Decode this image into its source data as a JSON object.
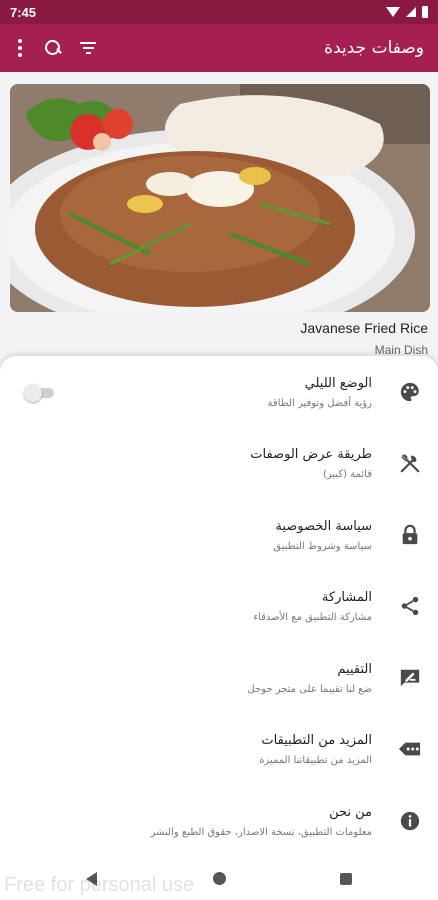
{
  "status_bar": {
    "time": "7:45"
  },
  "app_bar": {
    "title": "وصفات جديدة"
  },
  "recipe": {
    "title": "Javanese Fried Rice",
    "category": "Main Dish"
  },
  "menu": {
    "items": [
      {
        "title": "الوضع الليلي",
        "subtitle": "رؤية أفضل وتوفير الطاقة",
        "icon": "palette-icon"
      },
      {
        "title": "طريقة عرض الوصفات",
        "subtitle": "قائمة (كبير)",
        "icon": "utensils-icon"
      },
      {
        "title": "سياسة الخصوصية",
        "subtitle": "سياسة وشروط التطبيق",
        "icon": "lock-icon"
      },
      {
        "title": "المشاركة",
        "subtitle": "مشاركة التطبيق مع الأصدقاء",
        "icon": "share-icon"
      },
      {
        "title": "التقييم",
        "subtitle": "ضع لنا تقييما على متجر جوجل",
        "icon": "rate-review-icon"
      },
      {
        "title": "المزيد من التطبيقات",
        "subtitle": "المزيد من تطبيقاتنا المميزة",
        "icon": "more-apps-icon"
      },
      {
        "title": "من نحن",
        "subtitle": "معلومات التطبيق، نسخة الاصدار، حقوق الطبع والنشر",
        "icon": "info-icon"
      }
    ],
    "night_mode_enabled": false
  },
  "watermark": "Free for personal use",
  "colors": {
    "status_bar": "#8a1a42",
    "app_bar": "#a51f50",
    "icon": "#4a4a4a"
  }
}
